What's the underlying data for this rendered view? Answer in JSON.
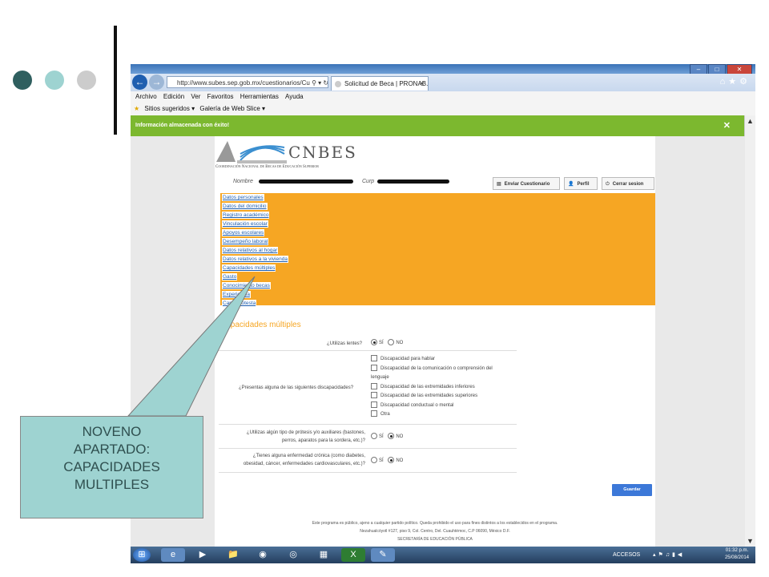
{
  "browser": {
    "address": "http://www.subes.sep.gob.mx/cuestionarios/Cu",
    "tab_title": "Solicitud de Beca | PRONAB...",
    "menu": [
      "Archivo",
      "Edición",
      "Ver",
      "Favoritos",
      "Herramientas",
      "Ayuda"
    ],
    "favorites": [
      "Sitios sugeridos ▾",
      "Galería de Web Slice ▾"
    ]
  },
  "notification": "Información almacenada con éxito!",
  "site": {
    "logo": "CNBES",
    "logo_sub": "Coordinación Nacional de Becas de Educación Superior",
    "nombre_label": "Nombre",
    "curp_label": "Curp",
    "buttons": {
      "enviar": "Enviar Cuestionario",
      "perfil": "Perfil",
      "cerrar": "Cerrar sesion"
    }
  },
  "nav": [
    "Datos personales",
    "Datos del domicilio",
    "Registro académico",
    "Vinculación escolar",
    "Apoyos escolares",
    "Desempeño laboral",
    "Datos relativos al hogar",
    "Datos relativos a la vivienda",
    "Capacidades múltiples",
    "Gasto",
    "Conocimiento becas",
    "Experiencia",
    "Carta protesta"
  ],
  "form": {
    "title": "Capacidades múltiples",
    "q1": {
      "label": "¿Utilizas lentes?",
      "si": "SÍ",
      "no": "NO",
      "selected": "si"
    },
    "q2": {
      "label": "¿Presentas alguna de las siguientes discapacidades?",
      "options": [
        "Discapacidad para hablar",
        "Discapacidad de la comunicación o comprensión del lenguaje",
        "Discapacidad de las extremidades inferiores",
        "Discapacidad de las extremidades superiores",
        "Discapacidad conductual o mental",
        "Otra"
      ]
    },
    "q3": {
      "label_1": "¿Utilizas algún tipo de prótesis y/o auxiliares (bastones,",
      "label_2": "perros, aparatos para la sordera, etc.)?",
      "si": "SÍ",
      "no": "NO",
      "selected": "no"
    },
    "q4": {
      "label_1": "¿Tienes alguna enfermedad crónica (como diabetes,",
      "label_2": "obesidad, cáncer, enfermedades cardiovasculares, etc.)?",
      "si": "SÍ",
      "no": "NO",
      "selected": "no"
    },
    "save": "Guardar"
  },
  "footer": {
    "line1": "Este programa es público, ajeno a cualquier partido político. Queda prohibido el uso para fines distintos a los establecidos en el programa.",
    "line2": "Nezahualcóyotl #127, piso 9, Col. Centro, Del. Cuauhtémoc, C.P 06090, México D.F.",
    "line3": "SECRETARÍA DE EDUCACIÓN PÚBLICA"
  },
  "taskbar": {
    "accesos": "ACCESOS",
    "time": "01:32 p.m.",
    "date": "25/08/2014"
  },
  "callout": {
    "line1": "NOVENO",
    "line2": "APARTADO:",
    "line3": "CAPACIDADES",
    "line4": "MULTIPLES"
  },
  "colors": {
    "dot1": "#2f5f5f",
    "dot2": "#9ed3d1",
    "dot3": "#cccccc",
    "accent": "#f6a623",
    "green": "#7cb82f"
  }
}
